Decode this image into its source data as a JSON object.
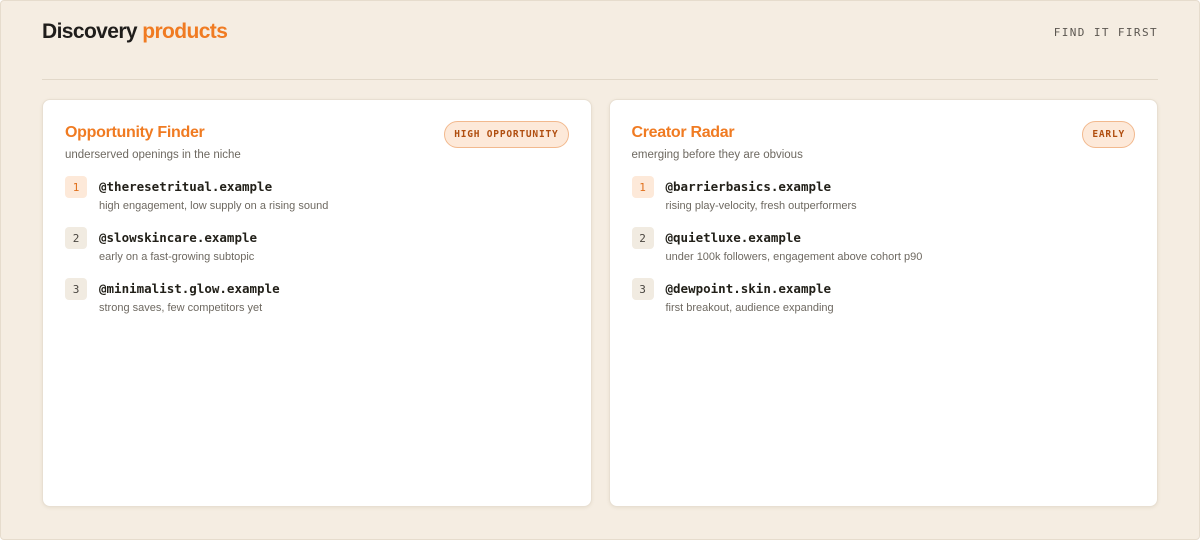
{
  "header": {
    "title_main": "Discovery",
    "title_accent": "products",
    "tagline": "FIND IT FIRST"
  },
  "colors": {
    "accent": "#f07b22",
    "background": "#f5ede2",
    "card": "#ffffff",
    "badge_bg": "#fde9d9"
  },
  "cards": [
    {
      "title": "Opportunity Finder",
      "subtitle": "underserved openings in the niche",
      "badge": "HIGH OPPORTUNITY",
      "items": [
        {
          "rank": "1",
          "handle": "@theresetritual.example",
          "note": "high engagement, low supply on a rising sound"
        },
        {
          "rank": "2",
          "handle": "@slowskincare.example",
          "note": "early on a fast-growing subtopic"
        },
        {
          "rank": "3",
          "handle": "@minimalist.glow.example",
          "note": "strong saves, few competitors yet"
        }
      ]
    },
    {
      "title": "Creator Radar",
      "subtitle": "emerging before they are obvious",
      "badge": "EARLY",
      "items": [
        {
          "rank": "1",
          "handle": "@barrierbasics.example",
          "note": "rising play-velocity, fresh outperformers"
        },
        {
          "rank": "2",
          "handle": "@quietluxe.example",
          "note": "under 100k followers, engagement above cohort p90"
        },
        {
          "rank": "3",
          "handle": "@dewpoint.skin.example",
          "note": "first breakout, audience expanding"
        }
      ]
    }
  ]
}
